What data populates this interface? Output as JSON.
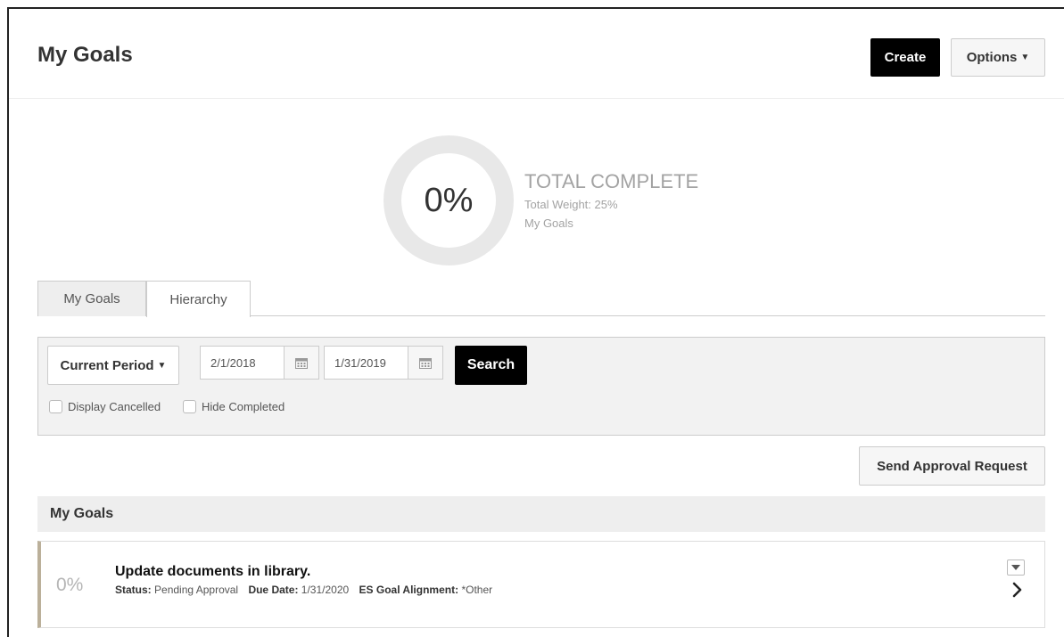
{
  "page": {
    "title": "My Goals"
  },
  "header": {
    "create_label": "Create",
    "options_label": "Options"
  },
  "summary": {
    "percent_label": "0%",
    "percent_value": 0,
    "total_complete_label": "TOTAL COMPLETE",
    "total_weight_label": "Total Weight: 25%",
    "sub_label": "My Goals"
  },
  "tabs": [
    {
      "label": "My Goals",
      "active": true
    },
    {
      "label": "Hierarchy",
      "active": false
    }
  ],
  "filters": {
    "period_label": "Current Period",
    "start_date": "2/1/2018",
    "end_date": "1/31/2019",
    "search_label": "Search",
    "display_cancelled_label": "Display Cancelled",
    "hide_completed_label": "Hide Completed"
  },
  "actions": {
    "send_approval_label": "Send Approval Request"
  },
  "section": {
    "title": "My Goals"
  },
  "goals": [
    {
      "percent": "0%",
      "title": "Update documents in library.",
      "status_label": "Status:",
      "status_value": "Pending Approval",
      "due_label": "Due Date:",
      "due_value": "1/31/2020",
      "alignment_label": "ES Goal Alignment:",
      "alignment_value": "*Other"
    }
  ],
  "icons": {
    "options": "caret-down-icon",
    "period": "caret-down-icon",
    "date_picker": "calendar-icon",
    "goal_menu": "caret-down-icon",
    "goal_open": "chevron-right-icon"
  },
  "colors": {
    "primary_button": "#000000",
    "donut_track": "#e8e8e8",
    "muted_text": "#a3a3a3",
    "goal_accent": "#bbb09a"
  }
}
